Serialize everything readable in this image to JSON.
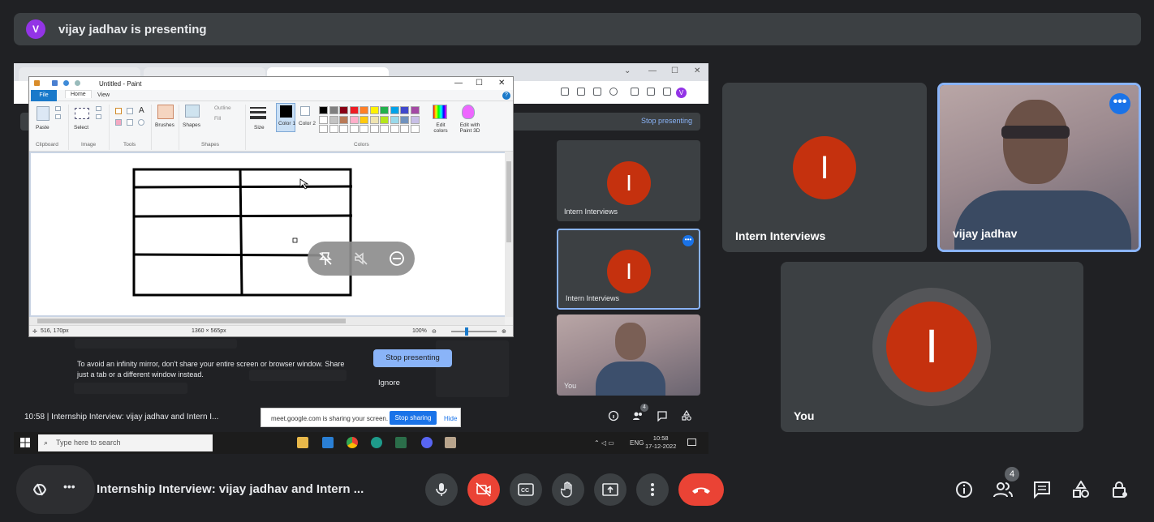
{
  "banner": {
    "avatar_letter": "V",
    "text": "vijay jadhav is presenting"
  },
  "shared_screen": {
    "paint": {
      "title": "Untitled - Paint",
      "tabs": {
        "file": "File",
        "home": "Home",
        "view": "View"
      },
      "ribbon": {
        "paste": "Paste",
        "select": "Select",
        "brushes": "Brushes",
        "shapes": "Shapes",
        "outline": "Outline",
        "fill": "Fill",
        "size": "Size",
        "color1": "Color 1",
        "color2": "Color 2",
        "edit_colors": "Edit colors",
        "edit_paint3d": "Edit with Paint 3D",
        "groups": {
          "clipboard": "Clipboard",
          "image": "Image",
          "tools": "Tools",
          "shapes": "Shapes",
          "colors": "Colors"
        }
      },
      "status": {
        "position": "516, 170px",
        "dimensions": "1360 × 565px",
        "zoom": "100%"
      }
    },
    "meet_stop_link": "Stop presenting",
    "mini_tiles": [
      {
        "letter": "I",
        "name": "Intern Interviews"
      },
      {
        "letter": "I",
        "name": "Intern Interviews"
      },
      {
        "name": "You"
      }
    ],
    "warning": "To avoid an infinity mirror, don't share your entire screen or browser window. Share just a tab or a different window instead.",
    "stop_presenting": "Stop presenting",
    "ignore": "Ignore",
    "meet_footer": {
      "time_title": "10:58  |  Internship Interview: vijay jadhav and Intern I...",
      "people_count": "4"
    },
    "sharing_notice": {
      "message": "meet.google.com is sharing your screen.",
      "stop_sharing": "Stop sharing",
      "hide": "Hide"
    },
    "taskbar": {
      "search_placeholder": "Type here to search",
      "lang": "ENG",
      "time": "10:58",
      "date": "17-12-2022"
    }
  },
  "tiles": {
    "intern": {
      "letter": "I",
      "name": "Intern Interviews"
    },
    "vijay": {
      "name": "vijay jadhav"
    },
    "you": {
      "letter": "I",
      "name": "You"
    }
  },
  "bottom": {
    "meeting_title": "Internship Interview: vijay jadhav and Intern ...",
    "more_dots": "•••",
    "people_badge": "4"
  },
  "colors": {
    "background": "#202124",
    "tile": "#3c4043",
    "avatar_red": "#c5310e",
    "end_call": "#ea4335",
    "accent_blue": "#8ab4f8",
    "presenter_purple": "#9334e6"
  }
}
